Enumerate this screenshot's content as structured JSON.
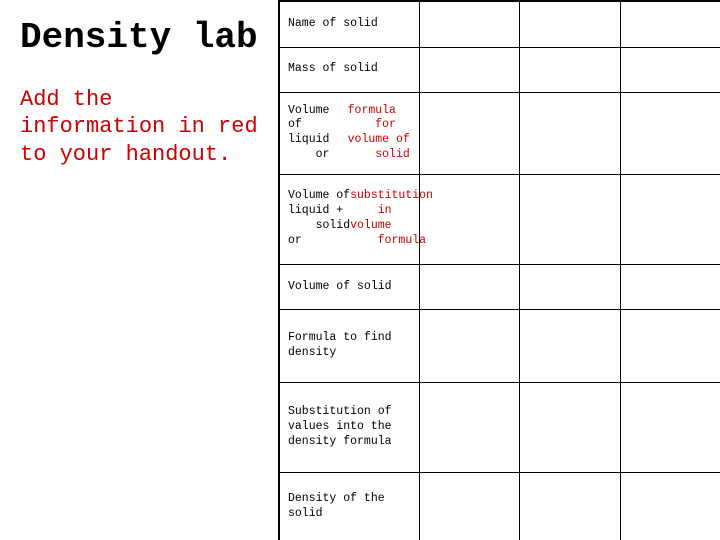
{
  "left": {
    "title": "Density lab",
    "subtitle_plain": "Add the information in ",
    "subtitle_red": "red",
    "subtitle_end": " to your handout."
  },
  "table": {
    "rows": [
      {
        "id": "name-of-solid",
        "label": "Name of solid",
        "label_red": false
      },
      {
        "id": "mass-of-solid",
        "label": "Mass of solid",
        "label_red": false
      },
      {
        "id": "volume-of-liquid",
        "label_parts": [
          {
            "text": "Volume of liquid",
            "red": false
          },
          {
            "text": " or ",
            "red": false
          },
          {
            "text": "formula for volume of solid",
            "red": true
          }
        ]
      },
      {
        "id": "volume-liquid-solid",
        "label_parts": [
          {
            "text": "Volume of liquid + solid or ",
            "red": false
          },
          {
            "text": "substitution in volume formula",
            "red": true
          }
        ]
      },
      {
        "id": "volume-of-solid",
        "label": "Volume of solid",
        "label_red": false
      },
      {
        "id": "formula-density",
        "label": "Formula to find density",
        "label_red": false
      },
      {
        "id": "substitution",
        "label": "Substitution of values into the density formula",
        "label_red": false
      },
      {
        "id": "density-of-solid",
        "label": "Density of the solid",
        "label_red": false
      }
    ]
  }
}
